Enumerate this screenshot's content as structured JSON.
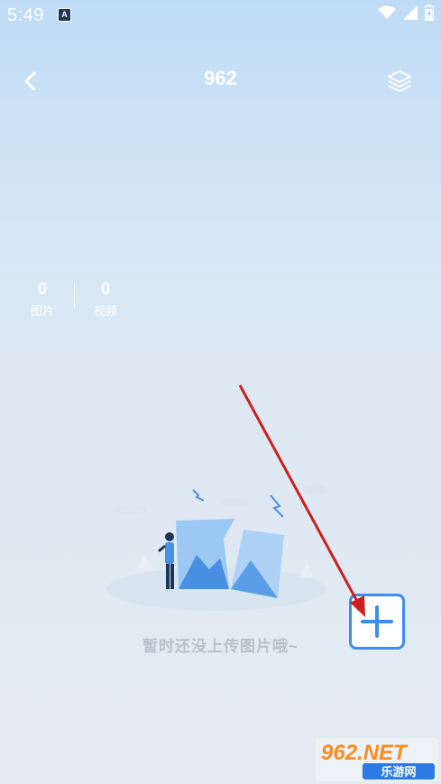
{
  "status_bar": {
    "time": "5:49",
    "notification_icon": "a-notification-icon",
    "icons": [
      "wifi-icon",
      "signal-icon",
      "battery-icon"
    ]
  },
  "header": {
    "title": "962",
    "back_icon": "chevron-left-icon",
    "layers_icon": "layers-icon"
  },
  "stats": {
    "photos": {
      "count": "0",
      "label": "图片"
    },
    "videos": {
      "count": "0",
      "label": "视频"
    }
  },
  "empty_state": {
    "message": "暂时还没上传图片哦~",
    "illustration": "person-with-photos-illustration"
  },
  "add_button": {
    "icon": "plus-icon"
  },
  "watermark": {
    "text_top": "962.NET",
    "text_bottom": "乐游网"
  },
  "colors": {
    "accent": "#3b8ef0",
    "annotation_arrow": "#cc1f1f",
    "empty_text": "#b8c2cc"
  }
}
